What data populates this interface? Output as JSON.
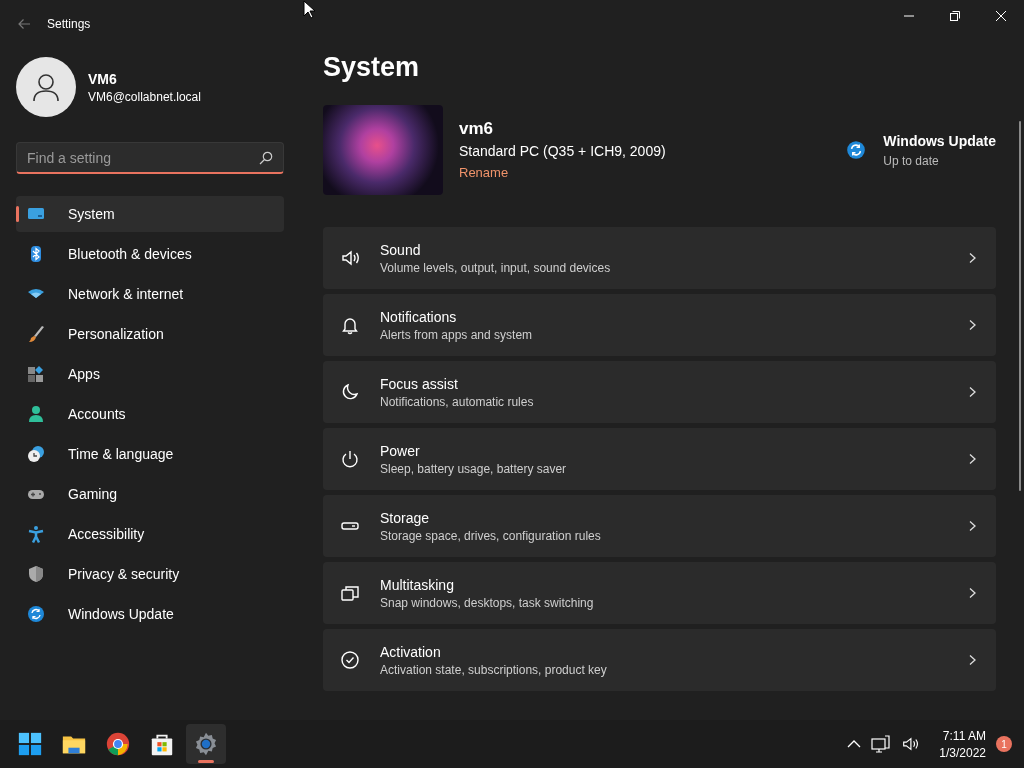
{
  "window": {
    "title": "Settings"
  },
  "account": {
    "name": "VM6",
    "email": "VM6@collabnet.local"
  },
  "search": {
    "placeholder": "Find a setting"
  },
  "sidebar": {
    "items": [
      {
        "label": "System",
        "selected": true
      },
      {
        "label": "Bluetooth & devices",
        "selected": false
      },
      {
        "label": "Network & internet",
        "selected": false
      },
      {
        "label": "Personalization",
        "selected": false
      },
      {
        "label": "Apps",
        "selected": false
      },
      {
        "label": "Accounts",
        "selected": false
      },
      {
        "label": "Time & language",
        "selected": false
      },
      {
        "label": "Gaming",
        "selected": false
      },
      {
        "label": "Accessibility",
        "selected": false
      },
      {
        "label": "Privacy & security",
        "selected": false
      },
      {
        "label": "Windows Update",
        "selected": false
      }
    ]
  },
  "page": {
    "title": "System"
  },
  "device": {
    "name": "vm6",
    "model": "Standard PC (Q35 + ICH9, 2009)",
    "rename": "Rename"
  },
  "update": {
    "title": "Windows Update",
    "status": "Up to date"
  },
  "settings": [
    {
      "title": "Sound",
      "description": "Volume levels, output, input, sound devices"
    },
    {
      "title": "Notifications",
      "description": "Alerts from apps and system"
    },
    {
      "title": "Focus assist",
      "description": "Notifications, automatic rules"
    },
    {
      "title": "Power",
      "description": "Sleep, battery usage, battery saver"
    },
    {
      "title": "Storage",
      "description": "Storage space, drives, configuration rules"
    },
    {
      "title": "Multitasking",
      "description": "Snap windows, desktops, task switching"
    },
    {
      "title": "Activation",
      "description": "Activation state, subscriptions, product key"
    }
  ],
  "taskbar": {
    "apps": [
      {
        "selected": false
      },
      {
        "selected": false
      },
      {
        "selected": false
      },
      {
        "selected": false
      },
      {
        "selected": true
      }
    ]
  },
  "tray": {
    "time": "7:11 AM",
    "date": "1/3/2022",
    "notifications": "1"
  }
}
